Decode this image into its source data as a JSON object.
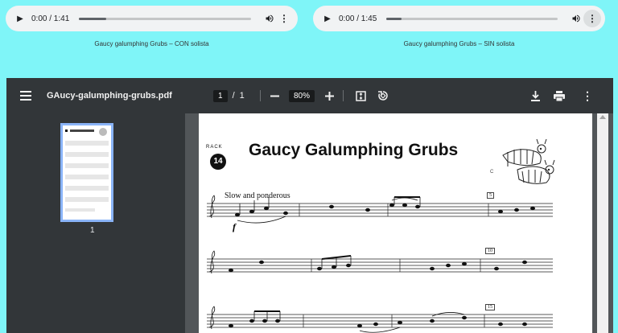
{
  "audio_players": [
    {
      "time": "0:00 / 1:41",
      "progress": 0.16,
      "caption": "Gaucy galumphing Grubs – CON solista"
    },
    {
      "time": "0:00 / 1:45",
      "progress": 0.09,
      "caption": "Gaucy galumphing Grubs – SIN solista"
    }
  ],
  "pdf": {
    "filename": "GAucy-galumphing-grubs.pdf",
    "current_page": "1",
    "page_separator": "/",
    "total_pages": "1",
    "zoom": "80%",
    "thumbnail_label": "1"
  },
  "score": {
    "track_label": "RACK",
    "track_number": "14",
    "title": "Gaucy Galumphing Grubs",
    "tempo": "Slow and ponderous",
    "dynamic": "f",
    "measure_numbers": [
      "5",
      "10",
      "15"
    ],
    "corner_letter": "C"
  },
  "icons": [
    "play-icon",
    "volume-icon",
    "more-vert-icon",
    "menu-icon",
    "zoom-out-icon",
    "zoom-in-icon",
    "fit-page-icon",
    "rotate-icon",
    "download-icon",
    "print-icon"
  ],
  "colors": {
    "background": "#7ff5f8",
    "toolbar": "#323639",
    "viewer": "#525659",
    "thumb_border": "#8ab4f8"
  }
}
